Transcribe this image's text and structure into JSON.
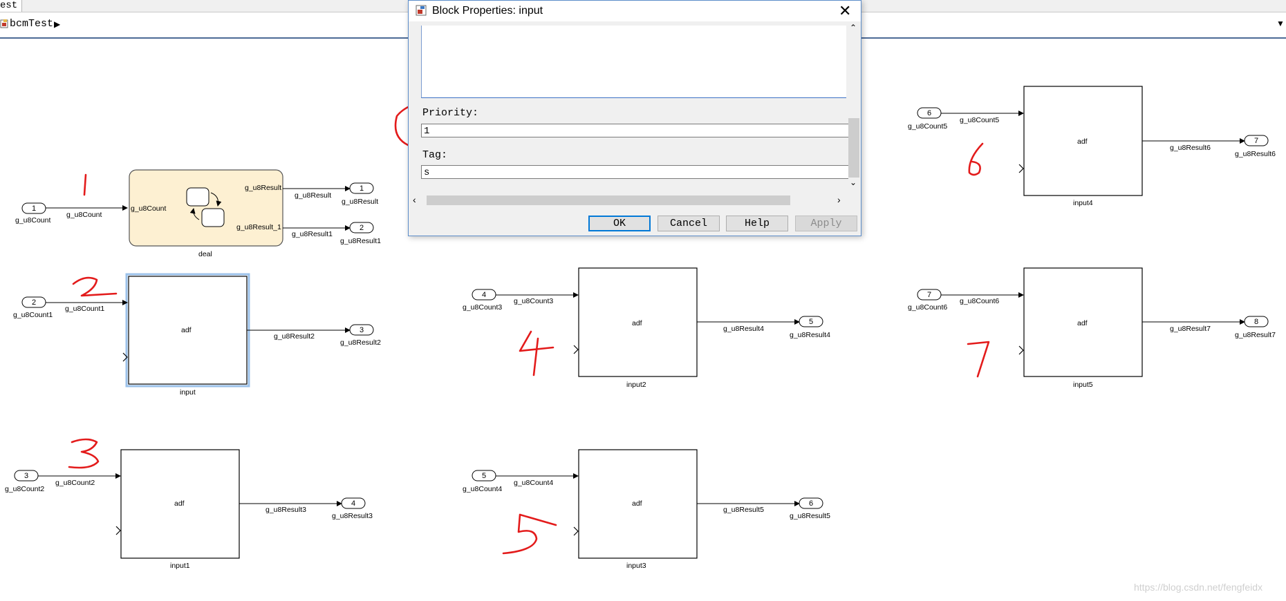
{
  "window": {
    "tab_title": "est"
  },
  "breadcrumb": {
    "model": "bcmTest"
  },
  "dialog": {
    "title": "Block Properties: input",
    "priority_label": "Priority:",
    "priority_value": "1",
    "tag_label": "Tag:",
    "tag_value": "s",
    "buttons": {
      "ok": "OK",
      "cancel": "Cancel",
      "help": "Help",
      "apply": "Apply"
    }
  },
  "diagram": {
    "chart_block": {
      "name": "deal",
      "in_port": "g_u8Count",
      "out_port1": "g_u8Result",
      "out_port2": "g_u8Result_1"
    },
    "subsystems": [
      {
        "name": "input",
        "text": "adf"
      },
      {
        "name": "input1",
        "text": "adf"
      },
      {
        "name": "input2",
        "text": "adf"
      },
      {
        "name": "input3",
        "text": "adf"
      },
      {
        "name": "input4",
        "text": "adf"
      },
      {
        "name": "input5",
        "text": "adf"
      }
    ],
    "inports": [
      {
        "num": "1",
        "name": "g_u8Count",
        "signal": "g_u8Count"
      },
      {
        "num": "2",
        "name": "g_u8Count1",
        "signal": "g_u8Count1"
      },
      {
        "num": "3",
        "name": "g_u8Count2",
        "signal": "g_u8Count2"
      },
      {
        "num": "4",
        "name": "g_u8Count3",
        "signal": "g_u8Count3"
      },
      {
        "num": "5",
        "name": "g_u8Count4",
        "signal": "g_u8Count4"
      },
      {
        "num": "6",
        "name": "g_u8Count5",
        "signal": "g_u8Count5"
      },
      {
        "num": "7",
        "name": "g_u8Count6",
        "signal": "g_u8Count6"
      }
    ],
    "outports": [
      {
        "num": "1",
        "name": "g_u8Result",
        "signal": "g_u8Result"
      },
      {
        "num": "2",
        "name": "g_u8Result1",
        "signal": "g_u8Result1"
      },
      {
        "num": "3",
        "name": "g_u8Result2",
        "signal": "g_u8Result2"
      },
      {
        "num": "4",
        "name": "g_u8Result3",
        "signal": "g_u8Result3"
      },
      {
        "num": "5",
        "name": "g_u8Result4",
        "signal": "g_u8Result4"
      },
      {
        "num": "6",
        "name": "g_u8Result5",
        "signal": "g_u8Result5"
      },
      {
        "num": "7",
        "name": "g_u8Result6",
        "signal": "g_u8Result6"
      },
      {
        "num": "8",
        "name": "g_u8Result7",
        "signal": "g_u8Result7"
      }
    ]
  },
  "watermark": "https://blog.csdn.net/fengfeidx",
  "colors": {
    "annotation_red": "#e31b1b",
    "chart_fill": "#fdf0d2",
    "selection_blue": "#9cc2ea"
  }
}
